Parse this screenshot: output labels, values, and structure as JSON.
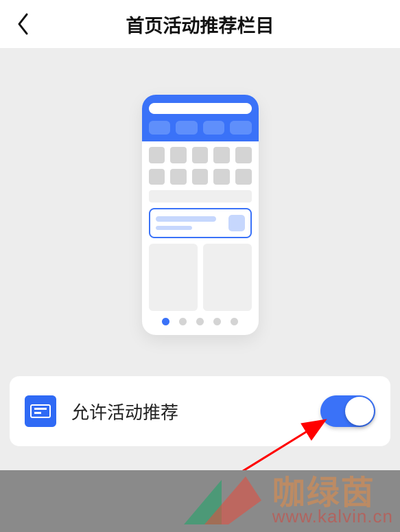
{
  "header": {
    "title": "首页活动推荐栏目"
  },
  "setting": {
    "label": "允许活动推荐",
    "enabled": true
  },
  "watermark": {
    "brand": "咖绿茵",
    "url": "www.kalvin.cn"
  }
}
